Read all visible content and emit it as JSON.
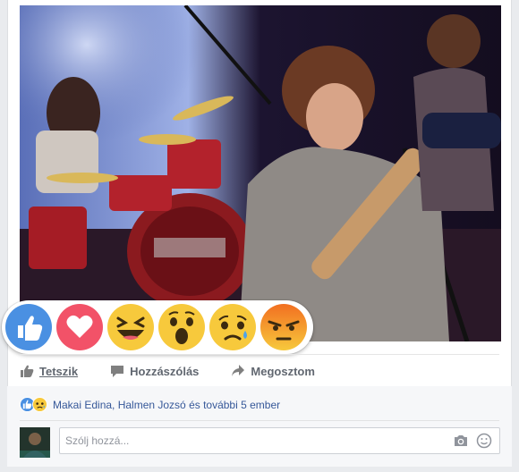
{
  "post": {
    "photo_alt": "Concert photo"
  },
  "reactions": [
    {
      "name": "like",
      "color": "#4a90e2"
    },
    {
      "name": "love",
      "color": "#f25268"
    },
    {
      "name": "haha",
      "color": "#f7c93c"
    },
    {
      "name": "wow",
      "color": "#f7c93c"
    },
    {
      "name": "sad",
      "color": "#f7c93c"
    },
    {
      "name": "angry",
      "color": "#f26f21"
    }
  ],
  "actions": {
    "like_label": "Tetszik",
    "comment_label": "Hozzászólás",
    "share_label": "Megosztom"
  },
  "summary": {
    "text": "Makai Edina, Halmen Jozsó és további 5 ember"
  },
  "comment": {
    "placeholder": "Szólj hozzá..."
  },
  "colors": {
    "link": "#365899",
    "action_text": "#616770",
    "like_blue": "#4a90e2",
    "angry_orange": "#f26f21"
  },
  "icons": [
    "like-icon",
    "comment-icon",
    "share-icon",
    "camera-icon",
    "emoji-icon"
  ]
}
